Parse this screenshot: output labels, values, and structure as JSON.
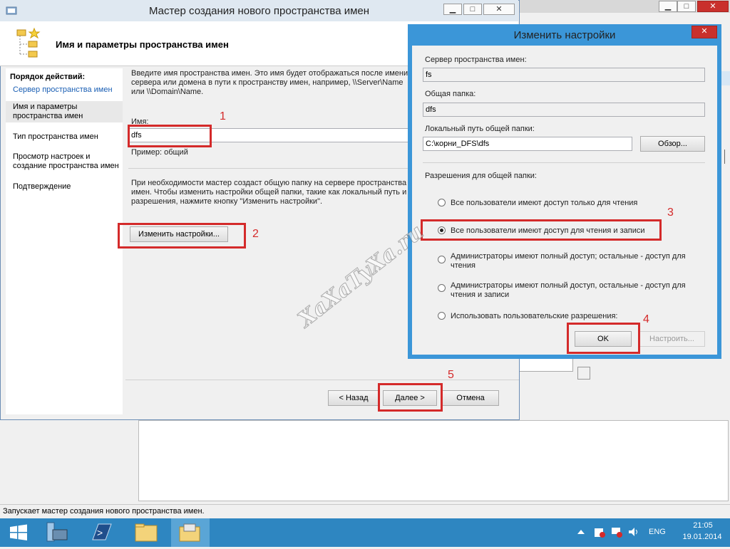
{
  "wizard": {
    "title": "Мастер создания нового пространства имен",
    "header": "Имя и параметры пространства имен",
    "steps_title": "Порядок действий:",
    "steps": [
      "Сервер пространства имен",
      "Имя и параметры пространства имен",
      "Тип пространства имен",
      "Просмотр настроек и создание пространства имен",
      "Подтверждение"
    ],
    "intro": "Введите имя пространства имен. Это имя будет отображаться после имени сервера или домена в пути к пространству имен, например, \\\\Server\\Name или \\\\Domain\\Name.",
    "name_label": "Имя:",
    "name_value": "dfs",
    "example": "Пример: общий",
    "info": "При необходимости мастер создаст общую папку на сервере пространства имен. Чтобы изменить настройки общей папки, такие как локальный путь и разрешения, нажмите кнопку \"Изменить настройки\".",
    "edit_button": "Изменить настройки...",
    "back_button": "< Назад",
    "next_button": "Далее >",
    "cancel_button": "Отмена",
    "min_glyph": "▁",
    "max_glyph": "□",
    "close_glyph": "✕"
  },
  "dialog": {
    "title": "Изменить настройки",
    "close_glyph": "✕",
    "server_label": "Сервер пространства имен:",
    "server_value": "fs",
    "share_label": "Общая папка:",
    "share_value": "dfs",
    "path_label": "Локальный путь общей папки:",
    "path_value": "C:\\корни_DFS\\dfs",
    "browse_button": "Обзор...",
    "perm_label": "Разрешения для общей папки:",
    "options": [
      "Все пользователи имеют доступ только для чтения",
      "Все пользователи имеют доступ для чтения и записи",
      "Администраторы имеют полный доступ; остальные - доступ для чтения",
      "Администраторы имеют полный доступ, остальные - доступ для чтения и записи",
      "Использовать пользовательские разрешения:"
    ],
    "selected_option": 1,
    "ok_button": "OK",
    "custom_button": "Настроить..."
  },
  "annotations": [
    "1",
    "2",
    "3",
    "4",
    "5"
  ],
  "watermark": "XaXaTyXa.ru",
  "status_text": "Запускает мастер создания нового пространства имен.",
  "tray": {
    "lang": "ENG",
    "time": "21:05",
    "date": "19.01.2014"
  },
  "colors": {
    "accent": "#3b96d8",
    "taskbar": "#2e86c1",
    "highlight": "#d42a2a"
  }
}
